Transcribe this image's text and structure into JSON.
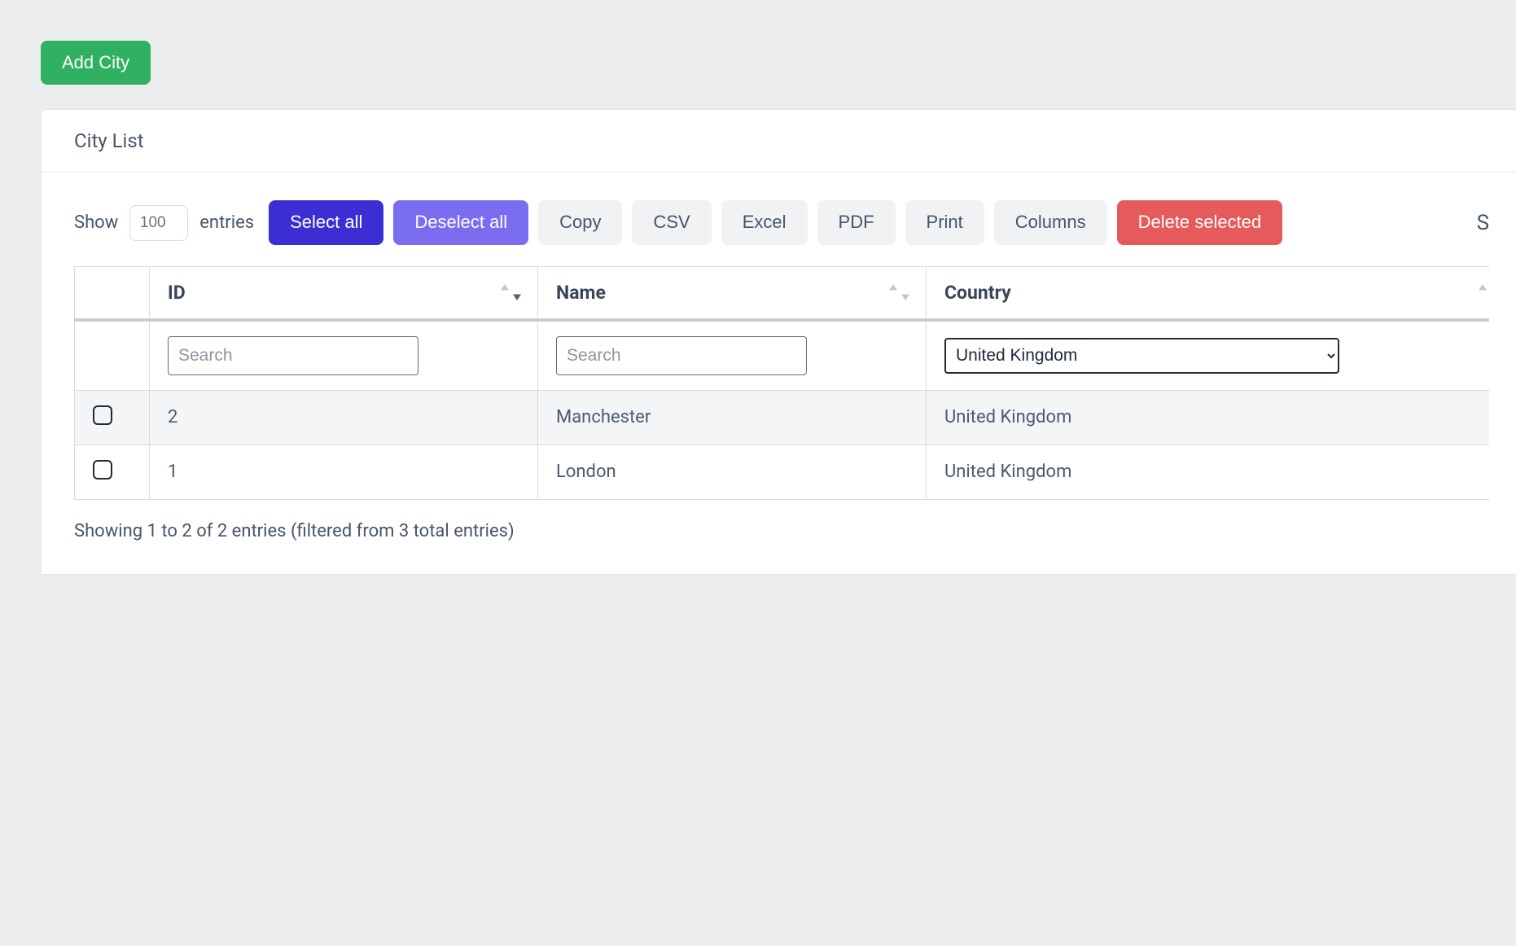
{
  "top": {
    "add_city_label": "Add City"
  },
  "card": {
    "title": "City List"
  },
  "controls": {
    "show_label": "Show",
    "entries_value": "100",
    "entries_label": "entries",
    "select_all": "Select all",
    "deselect_all": "Deselect all",
    "copy": "Copy",
    "csv": "CSV",
    "excel": "Excel",
    "pdf": "PDF",
    "print": "Print",
    "columns": "Columns",
    "delete_selected": "Delete selected",
    "state_tail": "S"
  },
  "table": {
    "headers": {
      "id": "ID",
      "name": "Name",
      "country": "Country"
    },
    "filters": {
      "id_placeholder": "Search",
      "name_placeholder": "Search",
      "country_selected": "United Kingdom"
    },
    "rows": [
      {
        "id": "2",
        "name": "Manchester",
        "country": "United Kingdom"
      },
      {
        "id": "1",
        "name": "London",
        "country": "United Kingdom"
      }
    ]
  },
  "footer": {
    "info": "Showing 1 to 2 of 2 entries (filtered from 3 total entries)"
  }
}
